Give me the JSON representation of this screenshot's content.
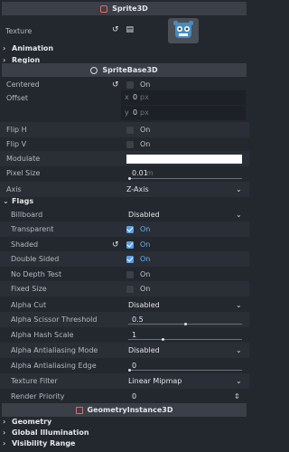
{
  "headers": {
    "sprite3d": "Sprite3D",
    "spritebase3d": "SpriteBase3D",
    "geometryinstance3d": "GeometryInstance3D"
  },
  "colors": {
    "accent": "#5a9ee6",
    "sprite_header_icon": "#e96868",
    "spritebase_header_icon": "#d9dcdf",
    "geometry_header_icon": "#e96868",
    "godot_blue": "#478cbf"
  },
  "top": {
    "texture_label": "Texture",
    "animation_label": "Animation",
    "region_label": "Region"
  },
  "props": {
    "centered": {
      "label": "Centered",
      "value": "On"
    },
    "offset": {
      "label": "Offset",
      "x_axis": "x",
      "x": "0",
      "y_axis": "y",
      "y": "0",
      "unit": "px"
    },
    "flip_h": {
      "label": "Flip H",
      "value": "On"
    },
    "flip_v": {
      "label": "Flip V",
      "value": "On"
    },
    "modulate": {
      "label": "Modulate",
      "color": "#ffffff"
    },
    "pixel_size": {
      "label": "Pixel Size",
      "value": "0.01",
      "unit": "m"
    },
    "axis": {
      "label": "Axis",
      "value": "Z-Axis"
    }
  },
  "flags": {
    "label": "Flags",
    "billboard": {
      "label": "Billboard",
      "value": "Disabled"
    },
    "transparent": {
      "label": "Transparent",
      "value": "On"
    },
    "shaded": {
      "label": "Shaded",
      "value": "On"
    },
    "double_sided": {
      "label": "Double Sided",
      "value": "On"
    },
    "no_depth_test": {
      "label": "No Depth Test",
      "value": "On"
    },
    "fixed_size": {
      "label": "Fixed Size",
      "value": "On"
    },
    "alpha_cut": {
      "label": "Alpha Cut",
      "value": "Disabled"
    },
    "alpha_scissor_threshold": {
      "label": "Alpha Scissor Threshold",
      "value": "0.5",
      "fraction": 0.5
    },
    "alpha_hash_scale": {
      "label": "Alpha Hash Scale",
      "value": "1",
      "fraction": 0.3
    },
    "alpha_aa_mode": {
      "label": "Alpha Antialiasing Mode",
      "value": "Disabled"
    },
    "alpha_aa_edge": {
      "label": "Alpha Antialiasing Edge",
      "value": "0",
      "fraction": 0.0
    },
    "texture_filter": {
      "label": "Texture Filter",
      "value": "Linear Mipmap"
    },
    "render_priority": {
      "label": "Render Priority",
      "value": "0"
    }
  },
  "bottom": {
    "geometry_label": "Geometry",
    "global_illumination_label": "Global Illumination",
    "visibility_range_label": "Visibility Range"
  }
}
